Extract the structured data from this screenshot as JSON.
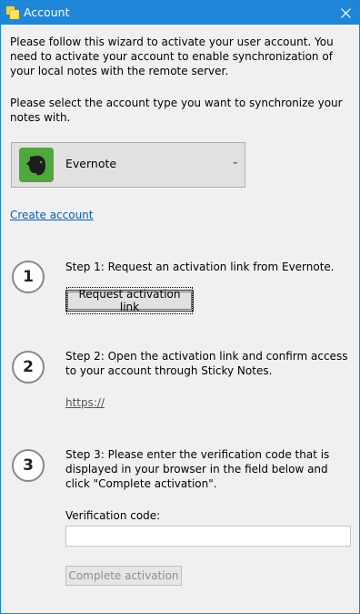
{
  "window": {
    "title": "Account",
    "close_glyph": "✕",
    "accent_color": "#1f86d8"
  },
  "intro_text": "Please follow this wizard to activate your user account. You need to activate your account to enable synchronization of your local notes with the remote server.",
  "select_label": "Please select the account type you want to synchronize your notes with.",
  "account_type": {
    "selected": "Evernote",
    "icon": "evernote-elephant-icon",
    "arrow": "⌄"
  },
  "create_account_link": "Create account",
  "steps": [
    {
      "number": "1",
      "text": "Step 1: Request an activation link from Evernote.",
      "button_label": "Request activation link"
    },
    {
      "number": "2",
      "text": "Step 2: Open the activation link and confirm access to your account through Sticky Notes.",
      "link_text": "https://"
    },
    {
      "number": "3",
      "text": "Step 3: Please enter the verification code that is displayed in your browser in the field below and click \"Complete activation\".",
      "field_label": "Verification code:",
      "field_value": "",
      "button_label": "Complete activation"
    }
  ]
}
